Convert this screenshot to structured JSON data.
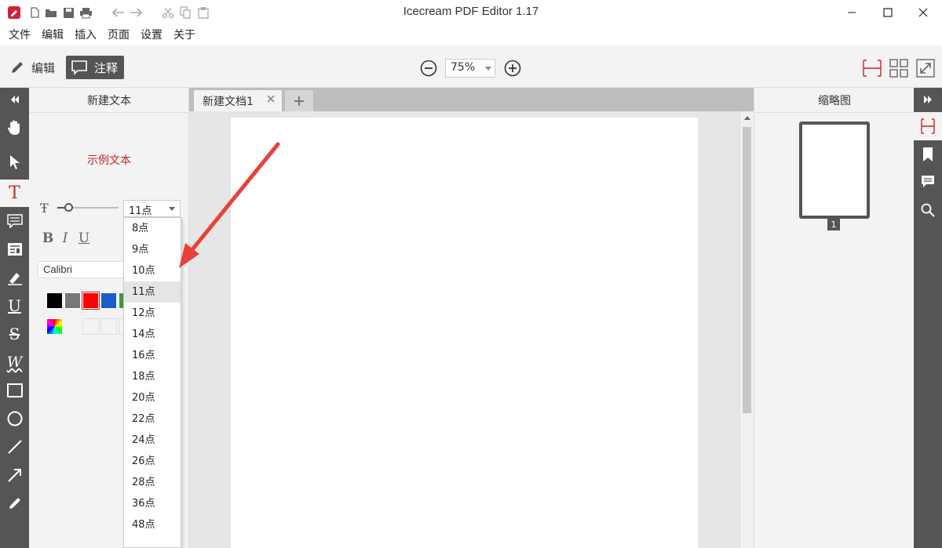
{
  "window": {
    "title": "Icecream PDF Editor 1.17",
    "quick_access_icons": [
      "app-logo-icon",
      "new-file-icon",
      "open-folder-icon",
      "save-icon",
      "print-icon",
      "undo-icon",
      "redo-icon",
      "cut-icon",
      "copy-icon",
      "paste-icon"
    ],
    "controls": [
      "minimize-icon",
      "maximize-icon",
      "close-icon"
    ]
  },
  "menu": [
    "文件",
    "编辑",
    "插入",
    "页面",
    "设置",
    "关于"
  ],
  "toolbar": {
    "edit_label": "编辑",
    "annotate_label": "注释",
    "zoom_value": "75%"
  },
  "left_panel": {
    "title": "新建文本",
    "sample_text": "示例文本",
    "font_size": "11点",
    "format_buttons": [
      "B",
      "I",
      "U"
    ],
    "font_name": "Calibri",
    "colors": [
      "#000000",
      "#777777",
      "#ff0000",
      "#1a5cc8",
      "#3c9a3c"
    ],
    "accent_color": "#c2272d"
  },
  "font_size_dropdown": {
    "options": [
      "8点",
      "9点",
      "10点",
      "11点",
      "12点",
      "14点",
      "16点",
      "18点",
      "20点",
      "22点",
      "24点",
      "26点",
      "28点",
      "36点",
      "48点"
    ],
    "selected": "11点"
  },
  "document": {
    "tab_label": "新建文档1"
  },
  "right_panel": {
    "title": "缩略图",
    "page_number": "1"
  }
}
